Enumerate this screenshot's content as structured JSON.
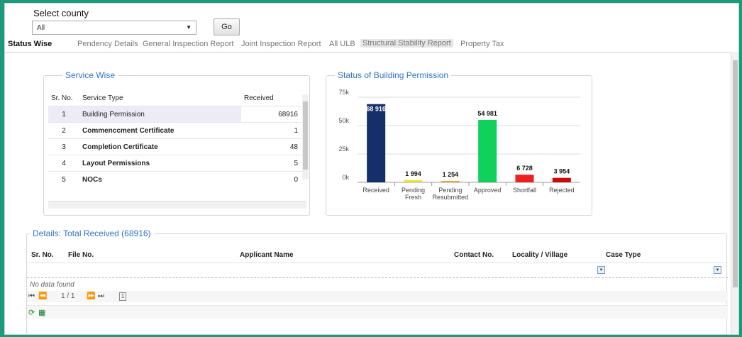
{
  "county": {
    "label": "Select county",
    "selected": "All",
    "go_label": "Go"
  },
  "tabs": [
    {
      "label": "Status Wise"
    },
    {
      "label": "Pendency Details"
    },
    {
      "label": "General Inspection Report"
    },
    {
      "label": "Joint Inspection Report"
    },
    {
      "label": "All ULB"
    },
    {
      "label": "Structural Stability Report"
    },
    {
      "label": "Property Tax"
    }
  ],
  "service_wise": {
    "title": "Service Wise",
    "columns": {
      "sr": "Sr. No.",
      "type": "Service Type",
      "received": "Received"
    },
    "rows": [
      {
        "sr": "1",
        "type": "Building Permission",
        "received": "68916"
      },
      {
        "sr": "2",
        "type": "Commenccment Certificate",
        "received": "1"
      },
      {
        "sr": "3",
        "type": "Completion Certificate",
        "received": "48"
      },
      {
        "sr": "4",
        "type": "Layout Permissions",
        "received": "5"
      },
      {
        "sr": "5",
        "type": "NOCs",
        "received": "0"
      }
    ]
  },
  "chart_title": "Status of Building Permission",
  "chart_data": {
    "type": "bar",
    "title": "Status of Building Permission",
    "categories": [
      [
        "Received"
      ],
      [
        "Pending",
        "Fresh"
      ],
      [
        "Pending",
        "Resubmitted"
      ],
      [
        "Approved"
      ],
      [
        "Shortfall"
      ],
      [
        "Rejected"
      ]
    ],
    "values": [
      68916,
      1994,
      1254,
      54981,
      6728,
      3954
    ],
    "labels": [
      "68 916",
      "1 994",
      "1 254",
      "54 981",
      "6 728",
      "3 954"
    ],
    "colors": [
      "#14306b",
      "#e8e43a",
      "#e8a93a",
      "#10d15a",
      "#ee1f1f",
      "#c80c0c"
    ],
    "yticks": [
      0,
      25000,
      50000,
      75000
    ],
    "ytick_labels": [
      "0k",
      "25k",
      "50k",
      "75k"
    ],
    "ylim": [
      0,
      75000
    ],
    "grid": true
  },
  "details": {
    "title": "Details: Total Received (68916)",
    "columns": {
      "sr": "Sr. No.",
      "file": "File No.",
      "applicant": "Applicant Name",
      "contact": "Contact No.",
      "locality": "Locality / Village",
      "case_type": "Case Type"
    },
    "empty_text": "No data found",
    "pager": {
      "page_info": "1 / 1",
      "page_number": "1"
    }
  }
}
